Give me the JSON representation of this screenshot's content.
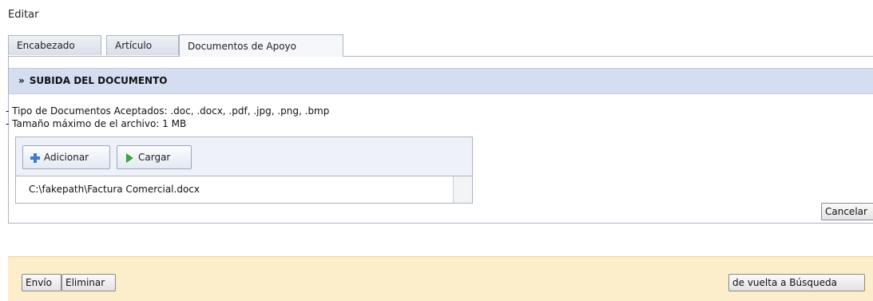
{
  "page": {
    "title": "Editar"
  },
  "tabs": [
    {
      "label": "Encabezado",
      "active": false
    },
    {
      "label": "Artículo",
      "active": false
    },
    {
      "label": "Documentos de Apoyo",
      "active": true
    }
  ],
  "upload": {
    "section_title": "SUBIDA DEL DOCUMENTO",
    "section_icon": "double-chevron-right-icon",
    "accepted_types": "- Tipo de Documentos Aceptados: .doc, .docx, .pdf, .jpg, .png, .bmp",
    "max_size": "- Tamaño máximo de el archivo: 1 MB",
    "add_label": "Adicionar",
    "add_icon": "plus-icon",
    "upload_label": "Cargar",
    "upload_icon": "play-arrow-icon",
    "file_path": "C:\\fakepath\\Factura Comercial.docx",
    "cancel_label": "Cancelar"
  },
  "footer": {
    "send_label": "Envío",
    "delete_label": "Eliminar",
    "back_label": "de vuelta a Búsqueda"
  },
  "colors": {
    "section_header_bg": "#d5def0",
    "footer_bg": "#fdeecb",
    "plus_icon": "#3a7bd5",
    "arrow_icon": "#3aa53a"
  }
}
